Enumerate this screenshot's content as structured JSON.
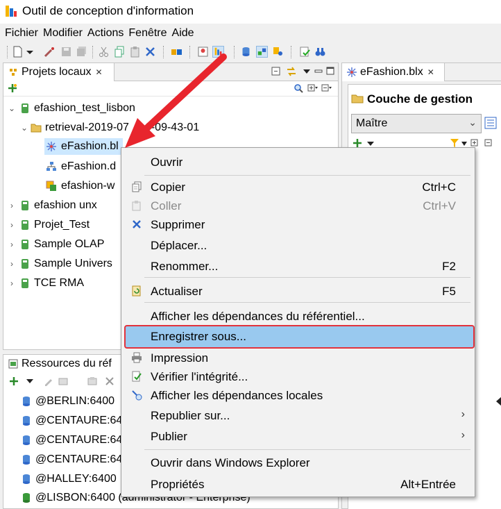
{
  "window": {
    "title": "Outil de conception d'information"
  },
  "menu": [
    "Fichier",
    "Modifier",
    "Actions",
    "Fenêtre",
    "Aide"
  ],
  "local_projects": {
    "tab_label": "Projets locaux",
    "close_glyph": "✕",
    "tree": [
      {
        "label": "efashion_test_lisbon",
        "expanded": true,
        "icon": "project-icon"
      },
      {
        "label": "retrieval-2019-07-?6-09-43-01",
        "visible_left": "retrieval-2019-07",
        "visible_right": "6-09-43-01",
        "expanded": true,
        "icon": "folder-open-icon"
      },
      {
        "label": "eFashion.blx",
        "visible": "eFashion.bl",
        "icon": "business-layer-icon",
        "selected": true
      },
      {
        "label": "eFashion.dfx",
        "visible": "eFashion.d",
        "icon": "data-foundation-icon"
      },
      {
        "label": "efashion-w",
        "visible": "efashion-w",
        "icon": "connection-icon"
      },
      {
        "label": "efashion unx",
        "icon": "project-icon"
      },
      {
        "label": "Projet_Test",
        "icon": "project-icon"
      },
      {
        "label": "Sample OLAP",
        "icon": "project-icon"
      },
      {
        "label": "Sample Univers",
        "visible": "Sample Univers",
        "icon": "project-icon"
      },
      {
        "label": "TCE RMA",
        "icon": "project-icon"
      }
    ]
  },
  "repo_resources": {
    "tab_label": "Ressources du réf",
    "items": [
      {
        "label": "@BERLIN:6400"
      },
      {
        "label": "@CENTAURE:64"
      },
      {
        "label": "@CENTAURE:64"
      },
      {
        "label": "@CENTAURE:64"
      },
      {
        "label": "@HALLEY:6400"
      },
      {
        "label": "@LISBON:6400 (administrator - Enterprise)"
      }
    ]
  },
  "editor": {
    "tab_label": "eFashion.blx",
    "section_title": "Couche de gestion",
    "dropdown_value": "Maître"
  },
  "context_menu": {
    "items": [
      {
        "label": "Ouvrir"
      },
      {
        "label": "Copier",
        "shortcut": "Ctrl+C",
        "icon": "copy-icon"
      },
      {
        "label": "Coller",
        "shortcut": "Ctrl+V",
        "icon": "paste-icon",
        "disabled": true
      },
      {
        "label": "Supprimer",
        "icon": "delete-icon"
      },
      {
        "label": "Déplacer..."
      },
      {
        "label": "Renommer...",
        "shortcut": "F2"
      },
      {
        "label": "Actualiser",
        "shortcut": "F5",
        "icon": "refresh-icon"
      },
      {
        "label": "Afficher les dépendances du référentiel..."
      },
      {
        "label": "Enregistrer sous...",
        "highlighted": true
      },
      {
        "label": "Impression",
        "icon": "print-icon"
      },
      {
        "label": "Vérifier l'intégrité...",
        "icon": "check-integrity-icon"
      },
      {
        "label": "Afficher les dépendances locales",
        "icon": "dependencies-icon"
      },
      {
        "label": "Republier sur...",
        "submenu": true
      },
      {
        "label": "Publier",
        "submenu": true
      },
      {
        "label": "Ouvrir dans Windows Explorer"
      },
      {
        "label": "Propriétés",
        "shortcut": "Alt+Entrée"
      }
    ]
  },
  "annotation": {
    "arrow_color": "#e8252d",
    "highlight_border": "#e2323c",
    "highlight_fill": "#99c9ef"
  }
}
